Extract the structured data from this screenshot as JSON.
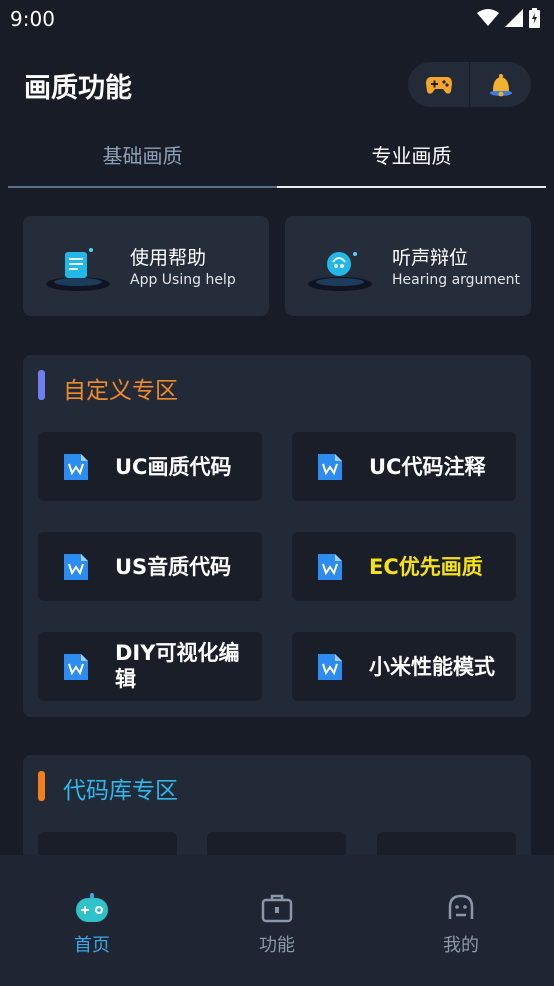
{
  "status_bar": {
    "time": "9:00"
  },
  "header": {
    "title": "画质功能",
    "icons": [
      "gamepad-icon",
      "bell-icon"
    ]
  },
  "tabs": [
    {
      "label": "基础画质",
      "active": false
    },
    {
      "label": "专业画质",
      "active": true
    }
  ],
  "help_cards": [
    {
      "title": "使用帮助",
      "subtitle": "App Using help"
    },
    {
      "title": "听声辩位",
      "subtitle": "Hearing argument"
    }
  ],
  "custom_section": {
    "title": "自定义专区",
    "accent": "#f08a2c",
    "bar_color": "#6f7ef0",
    "items": [
      {
        "label": "UC画质代码",
        "color": "#ffffff"
      },
      {
        "label": "UC代码注释",
        "color": "#ffffff"
      },
      {
        "label": "US音质代码",
        "color": "#ffffff"
      },
      {
        "label": "EC优先画质",
        "color": "#f5e216"
      },
      {
        "label": "DIY可视化编辑",
        "color": "#ffffff"
      },
      {
        "label": "小米性能模式",
        "color": "#ffffff"
      }
    ]
  },
  "library_section": {
    "title": "代码库专区",
    "accent": "#2fb7ec",
    "bar_color": "#f07f1c"
  },
  "bottom_nav": [
    {
      "label": "首页",
      "icon": "gamepad-home-icon",
      "active": true
    },
    {
      "label": "功能",
      "icon": "briefcase-icon",
      "active": false
    },
    {
      "label": "我的",
      "icon": "profile-icon",
      "active": false
    }
  ],
  "colors": {
    "background": "#171c27",
    "nav_active": "#3aa8e8",
    "nav_inactive": "#8a97ab"
  }
}
